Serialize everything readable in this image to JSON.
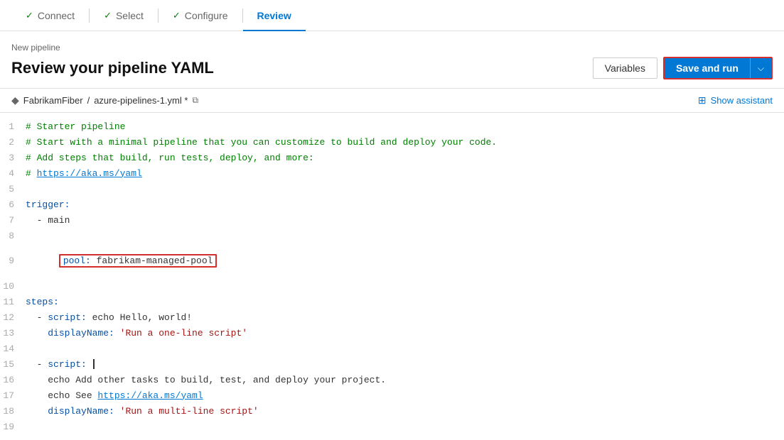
{
  "tabs": [
    {
      "id": "connect",
      "label": "Connect",
      "checked": true,
      "active": false
    },
    {
      "id": "select",
      "label": "Select",
      "checked": true,
      "active": false
    },
    {
      "id": "configure",
      "label": "Configure",
      "checked": true,
      "active": false
    },
    {
      "id": "review",
      "label": "Review",
      "checked": false,
      "active": true
    }
  ],
  "breadcrumb": "New pipeline",
  "page_title": "Review your pipeline YAML",
  "toolbar": {
    "variables_label": "Variables",
    "save_and_run_label": "Save and run"
  },
  "file": {
    "repo": "FabrikamFiber",
    "separator": "/",
    "filename": "azure-pipelines-1.yml *"
  },
  "show_assistant_label": "Show assistant",
  "code_lines": [
    {
      "num": "1",
      "type": "comment",
      "content": "# Starter pipeline"
    },
    {
      "num": "2",
      "type": "comment",
      "content": "# Start with a minimal pipeline that you can customize to build and deploy your code."
    },
    {
      "num": "3",
      "type": "comment",
      "content": "# Add steps that build, run tests, deploy, and more:"
    },
    {
      "num": "4",
      "type": "comment_link",
      "prefix": "# ",
      "link": "https://aka.ms/yaml",
      "suffix": ""
    },
    {
      "num": "5",
      "type": "blank"
    },
    {
      "num": "6",
      "type": "key",
      "content": "trigger:"
    },
    {
      "num": "7",
      "type": "plain",
      "content": "  - main"
    },
    {
      "num": "8",
      "type": "blank"
    },
    {
      "num": "9",
      "type": "pool",
      "content": "pool: fabrikam-managed-pool"
    },
    {
      "num": "10",
      "type": "blank"
    },
    {
      "num": "11",
      "type": "key",
      "content": "steps:"
    },
    {
      "num": "12",
      "type": "plain_with_key",
      "content": "  - script: echo Hello, world!"
    },
    {
      "num": "13",
      "type": "string_value",
      "content": "    displayName: 'Run a one-line script'"
    },
    {
      "num": "14",
      "type": "blank"
    },
    {
      "num": "15",
      "type": "script_cursor",
      "content": "  - script: "
    },
    {
      "num": "16",
      "type": "echo_link",
      "prefix": "    echo Add other tasks to build, test, and deploy your project."
    },
    {
      "num": "17",
      "type": "echo_link2",
      "prefix": "    echo See ",
      "link": "https://aka.ms/yaml"
    },
    {
      "num": "18",
      "type": "string_value",
      "content": "    displayName: 'Run a multi-line script'"
    },
    {
      "num": "19",
      "type": "blank"
    }
  ]
}
